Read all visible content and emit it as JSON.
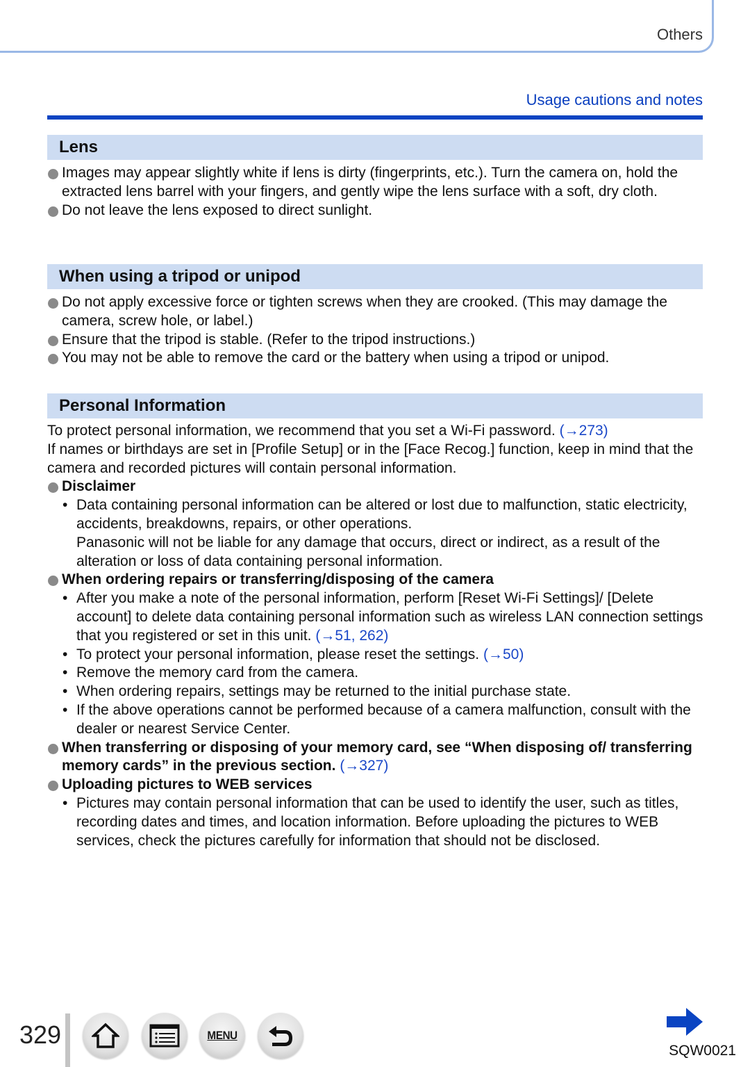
{
  "header": {
    "tab_label": "Others",
    "section_link": "Usage cautions and notes"
  },
  "colors": {
    "accent_blue": "#0a44c2",
    "heading_bg": "#cddcf2",
    "link_blue": "#1a47c8",
    "tab_outline": "#9ab8e6"
  },
  "sections": {
    "lens": {
      "title": "Lens",
      "items": [
        "Images may appear slightly white if lens is dirty (fingerprints, etc.). Turn the camera on, hold the extracted lens barrel with your fingers, and gently wipe the lens surface with a soft, dry cloth.",
        "Do not leave the lens exposed to direct sunlight."
      ]
    },
    "tripod": {
      "title": "When using a tripod or unipod",
      "items": [
        "Do not apply excessive force or tighten screws when they are crooked. (This may damage the camera, screw hole, or label.)",
        "Ensure that the tripod is stable. (Refer to the tripod instructions.)",
        "You may not be able to remove the card or the battery when using a tripod or unipod."
      ]
    },
    "personal": {
      "title": "Personal Information",
      "intro_1": "To protect personal information, we recommend that you set a Wi-Fi password.",
      "intro_1_ref": "(→273)",
      "intro_2": "If names or birthdays are set in [Profile Setup] or in the [Face Recog.] function, keep in mind that the camera and recorded pictures will contain personal information.",
      "disclaimer": {
        "title": "Disclaimer",
        "p1": "Data containing personal information can be altered or lost due to malfunction, static electricity, accidents, breakdowns, repairs, or other operations.",
        "p2": "Panasonic will not be liable for any damage that occurs, direct or indirect, as a result of the alteration or loss of data containing personal information."
      },
      "repairs": {
        "title": "When ordering repairs or transferring/disposing of the camera",
        "items": [
          {
            "text": "After you make a note of the personal information, perform [Reset Wi-Fi Settings]/ [Delete account] to delete data containing personal information such as wireless LAN connection settings that you registered or set in this unit.",
            "ref": "(→51, 262)"
          },
          {
            "text": "To protect your personal information, please reset the settings.",
            "ref": "(→50)"
          },
          {
            "text": "Remove the memory card from the camera.",
            "ref": ""
          },
          {
            "text": "When ordering repairs, settings may be returned to the initial purchase state.",
            "ref": ""
          },
          {
            "text": "If the above operations cannot be performed because of a camera malfunction, consult with the dealer or nearest Service Center.",
            "ref": ""
          }
        ]
      },
      "memory_card": {
        "text": "When transferring or disposing of your memory card, see “When disposing of/ transferring memory cards” in the previous section.",
        "ref": "(→327)"
      },
      "uploading": {
        "title": "Uploading pictures to WEB services",
        "p1": "Pictures may contain personal information that can be used to identify the user, such as titles, recording dates and times, and location information. Before uploading the pictures to WEB services, check the pictures carefully for information that should not be disclosed."
      }
    }
  },
  "footer": {
    "page_number": "329",
    "menu_label": "MENU",
    "model_code": "SQW0021",
    "buttons": [
      "home-icon",
      "contents-list-icon",
      "menu-icon",
      "back-icon"
    ],
    "next_icon": "arrow-right-icon"
  }
}
